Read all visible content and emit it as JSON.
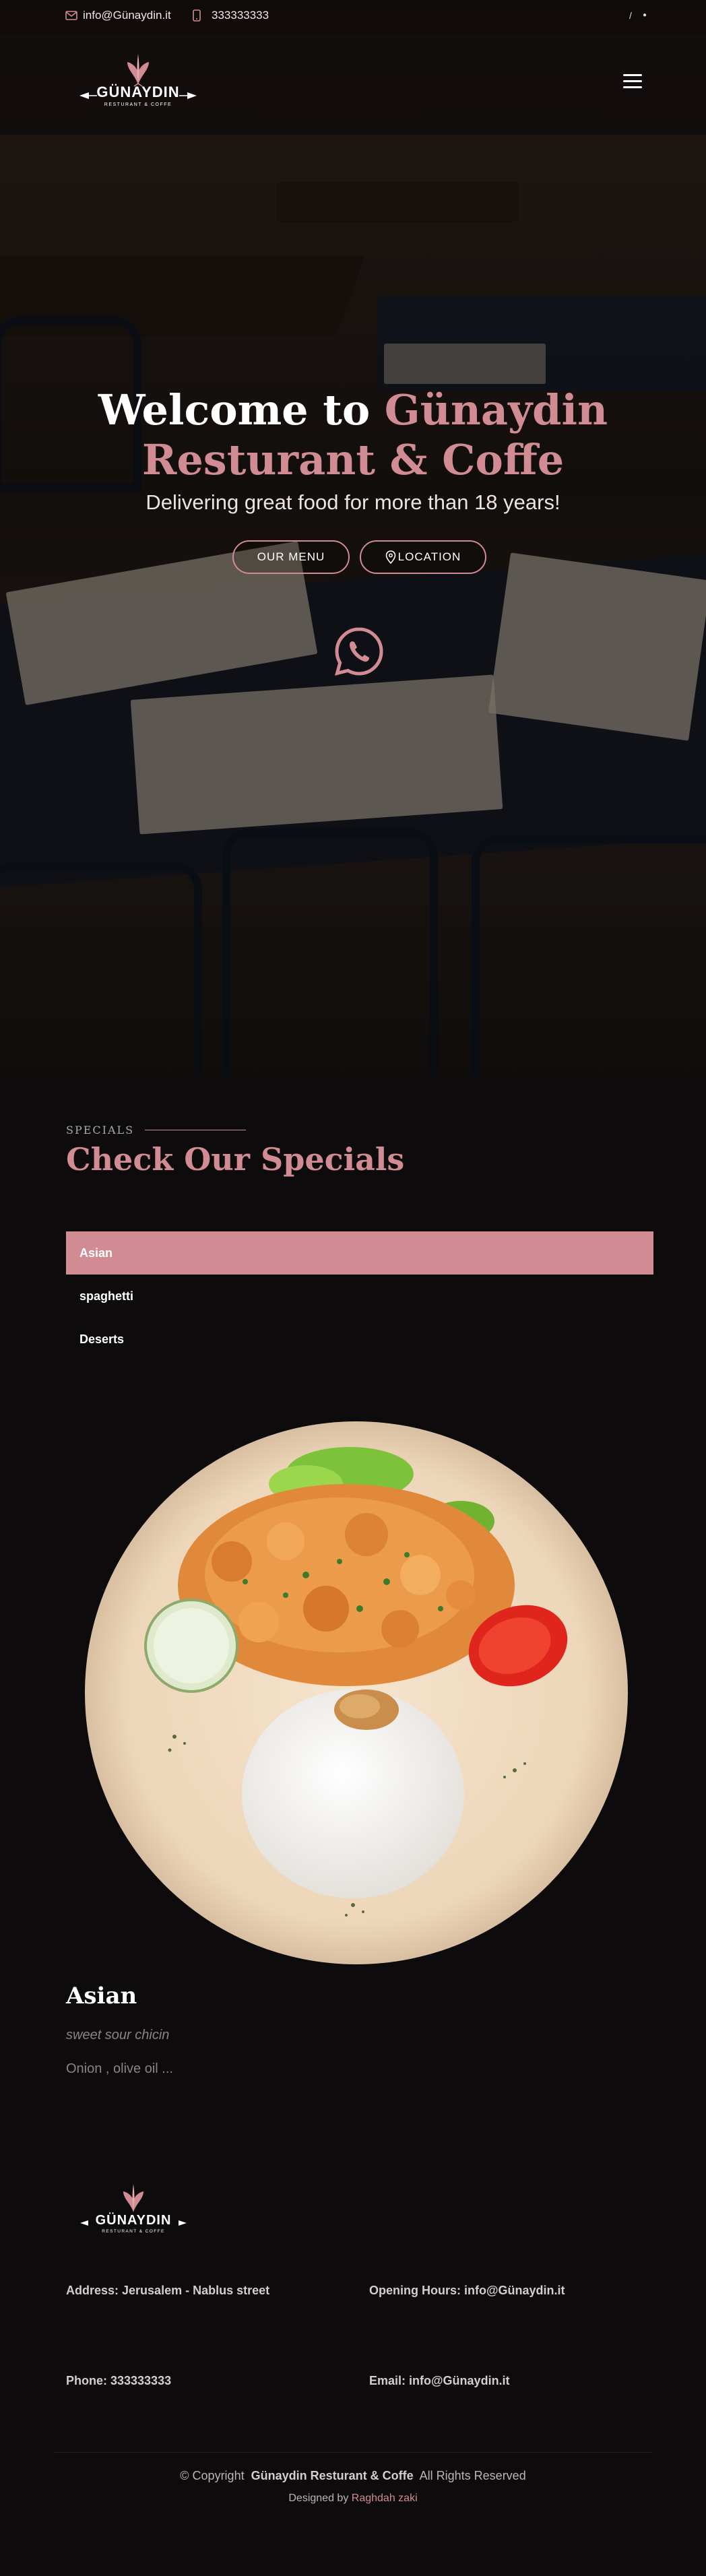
{
  "topbar": {
    "email": "info@Günaydin.it",
    "phone": "333333333",
    "social_1": "/",
    "social_2": "●",
    "email_icon": "envelope-icon",
    "phone_icon": "phone-icon"
  },
  "brand": {
    "logo_text": "GÜNAYDIN",
    "logo_tagline": "RESTURANT & COFFE"
  },
  "hero": {
    "title_white": "Welcome to ",
    "title_pink_1": "Günaydin",
    "title_pink_2": "Resturant & Coffe",
    "subtitle": "Delivering great food for more than 18 years!",
    "menu_button": "OUR MENU",
    "location_button": "LOCATION",
    "whatsapp_icon": "whatsapp-icon"
  },
  "specials": {
    "eyebrow": "SPECIALS",
    "title": "Check Our Specials",
    "tabs": [
      "Asian",
      "spaghetti",
      "Deserts"
    ],
    "dish": {
      "title": "Asian",
      "subtitle": "sweet sour chicin",
      "ingredients": "Onion , olive oil ..."
    }
  },
  "footer": {
    "address": "Address: Jerusalem - Nablus street",
    "hours": "Opening Hours: info@Günaydin.it",
    "phone": "Phone: 333333333",
    "email": "Email: info@Günaydin.it",
    "copyright_prefix": "© Copyright",
    "copyright_brand": "Günaydin Resturant & Coffe",
    "copyright_suffix": "All Rights Reserved",
    "designed_by_prefix": "Designed by",
    "designed_by_name": "Raghdah zaki"
  },
  "colors": {
    "accent": "#d18b92",
    "background": "#0d0b0b",
    "text": "#ffffff"
  }
}
